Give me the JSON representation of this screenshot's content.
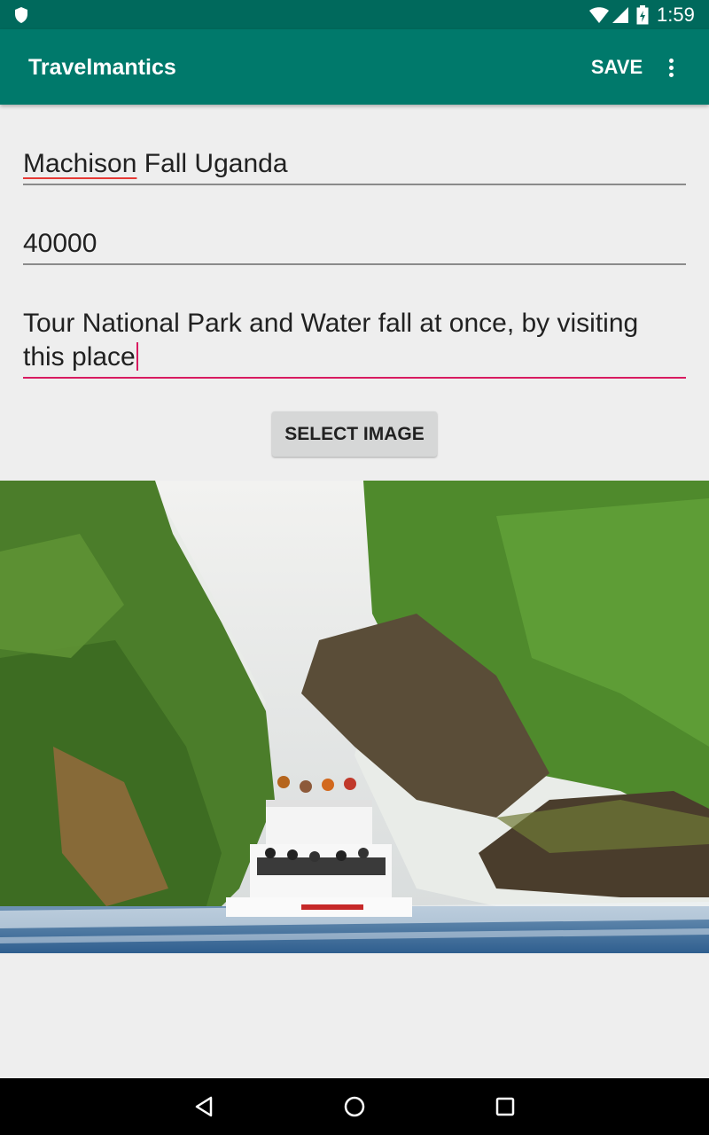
{
  "status_bar": {
    "time": "1:59"
  },
  "app_bar": {
    "title": "Travelmantics",
    "save_label": "SAVE"
  },
  "form": {
    "title_word1": "Machison",
    "title_rest": " Fall Uganda",
    "price": "40000",
    "description": "Tour National Park and Water fall at once, by visiting this place"
  },
  "select_image_label": "SELECT IMAGE",
  "colors": {
    "status_bar": "#00695c",
    "app_bar": "#00796b",
    "accent": "#d81b60"
  },
  "icons": [
    "shield-icon",
    "wifi-icon",
    "signal-icon",
    "battery-icon",
    "more-vert-icon",
    "back-icon",
    "home-icon",
    "recents-icon"
  ]
}
